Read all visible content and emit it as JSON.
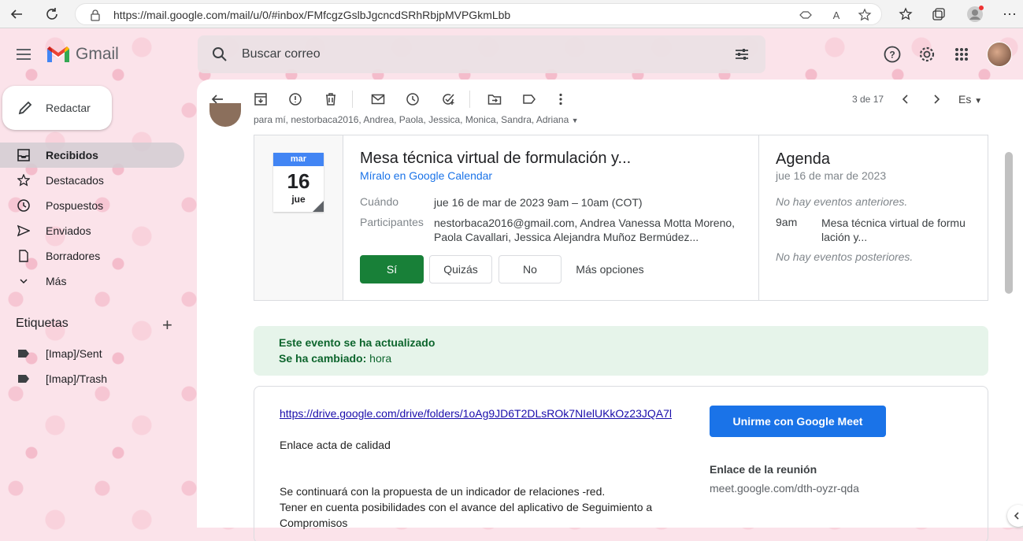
{
  "browser": {
    "url": "https://mail.google.com/mail/u/0/#inbox/FMfcgzGslbJgcncdSRhRbjpMVPGkmLbb"
  },
  "header": {
    "app_name": "Gmail",
    "search_placeholder": "Buscar correo"
  },
  "sidebar": {
    "compose_label": "Redactar",
    "items": [
      {
        "label": "Recibidos",
        "icon": "inbox-icon"
      },
      {
        "label": "Destacados",
        "icon": "star-icon"
      },
      {
        "label": "Pospuestos",
        "icon": "clock-icon"
      },
      {
        "label": "Enviados",
        "icon": "send-icon"
      },
      {
        "label": "Borradores",
        "icon": "draft-icon"
      },
      {
        "label": "Más",
        "icon": "chevron-down-icon"
      }
    ],
    "labels_heading": "Etiquetas",
    "labels": [
      {
        "label": "[Imap]/Sent"
      },
      {
        "label": "[Imap]/Trash"
      }
    ]
  },
  "toolbar": {
    "pager": "3 de 17",
    "language": "Es"
  },
  "message": {
    "recipients": "para mí, nestorbaca2016, Andrea, Paola, Jessica, Monica, Sandra, Adriana"
  },
  "invite": {
    "cal_month": "mar",
    "cal_day": "16",
    "cal_weekday": "jue",
    "title": "Mesa técnica virtual de formulación y...",
    "calendar_link": "Míralo en Google Calendar",
    "when_label": "Cuándo",
    "when_value": "jue 16 de mar de 2023 9am – 10am (COT)",
    "participants_label": "Participantes",
    "participants_line1": "nestorbaca2016@gmail.com, Andrea Vanessa Motta Moreno,",
    "participants_line2": "Paola Cavallari, Jessica Alejandra Muñoz Bermúdez...",
    "rsvp_yes": "Sí",
    "rsvp_maybe": "Quizás",
    "rsvp_no": "No",
    "more_options": "Más opciones"
  },
  "agenda": {
    "title": "Agenda",
    "date": "jue 16 de mar de 2023",
    "no_prev": "No hay eventos anteriores.",
    "event_time": "9am",
    "event_line1": "Mesa técnica virtual de formu",
    "event_line2": "lación y...",
    "no_next": "No hay eventos posteriores."
  },
  "update": {
    "line1": "Este evento se ha actualizado",
    "changed_label": "Se ha cambiado:",
    "changed_value": "hora"
  },
  "body": {
    "link": "https://drive.google.com/drive/folders/1oAg9JD6T2DLsROk7NIelUKkOz23JQA7l",
    "link_caption": "Enlace acta de calidad",
    "para1": "Se continuará con la propuesta de un indicador de relaciones -red.",
    "para2_line1": "Tener en cuenta posibilidades con el avance del aplicativo de Seguimiento a",
    "para2_line2": "Compromisos",
    "meet_button": "Unirme con Google Meet",
    "meet_label": "Enlace de la reunión",
    "meet_url": "meet.google.com/dth-oyzr-qda"
  }
}
